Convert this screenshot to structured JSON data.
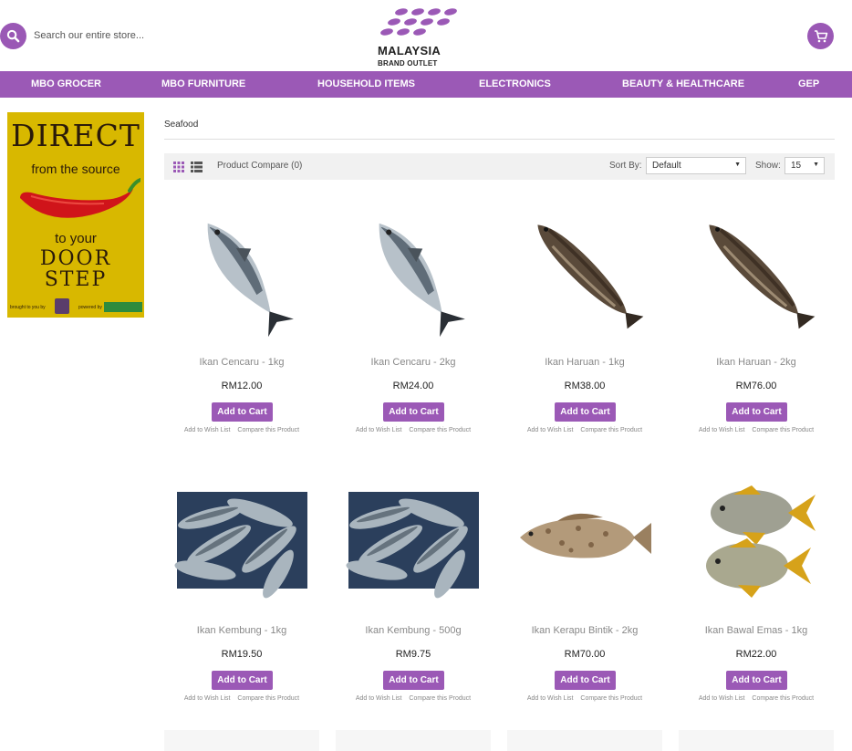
{
  "header": {
    "search_placeholder": "Search our entire store...",
    "logo_line1": "MALAYSIA",
    "logo_line2": "BRAND OUTLET",
    "accent": "#9b59b6"
  },
  "nav": [
    {
      "label": "MBO GROCER"
    },
    {
      "label": "MBO FURNITURE"
    },
    {
      "label": "HOUSEHOLD ITEMS"
    },
    {
      "label": "ELECTRONICS"
    },
    {
      "label": "BEAUTY & HEALTHCARE"
    },
    {
      "label": "GEP"
    }
  ],
  "banner": {
    "line1": "DIRECT",
    "line2": "from the source",
    "line3": "to your",
    "line4": "DOOR",
    "line5": "STEP",
    "brought": "brought to you by",
    "powered": "powered by"
  },
  "breadcrumb": "Seafood",
  "toolbar": {
    "compare": "Product Compare (0)",
    "sort_label": "Sort By:",
    "sort_value": "Default",
    "show_label": "Show:",
    "show_value": "15"
  },
  "products": [
    {
      "name": "Ikan Cencaru - 1kg",
      "price": "RM12.00",
      "image": "mackerel-fish-image"
    },
    {
      "name": "Ikan Cencaru - 2kg",
      "price": "RM24.00",
      "image": "mackerel-fish-image"
    },
    {
      "name": "Ikan Haruan - 1kg",
      "price": "RM38.00",
      "image": "snakehead-fish-image"
    },
    {
      "name": "Ikan Haruan - 2kg",
      "price": "RM76.00",
      "image": "snakehead-fish-image"
    },
    {
      "name": "Ikan Kembung - 1kg",
      "price": "RM19.50",
      "image": "kembung-pile-image"
    },
    {
      "name": "Ikan Kembung - 500g",
      "price": "RM9.75",
      "image": "kembung-pile-image"
    },
    {
      "name": "Ikan Kerapu Bintik - 2kg",
      "price": "RM70.00",
      "image": "grouper-fish-image"
    },
    {
      "name": "Ikan Bawal Emas - 1kg",
      "price": "RM22.00",
      "image": "pompano-fish-image"
    }
  ],
  "card_labels": {
    "add_to_cart": "Add to Cart",
    "wish_list": "Add to Wish List",
    "compare": "Compare this Product"
  }
}
